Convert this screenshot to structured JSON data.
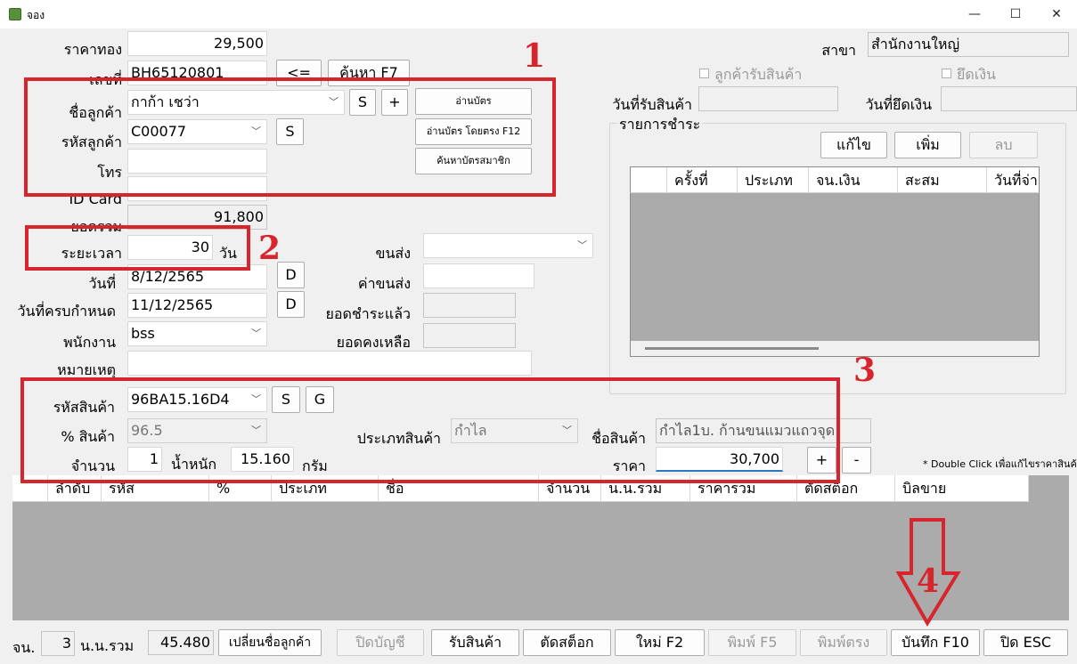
{
  "window": {
    "title": "จอง",
    "minimize": "—",
    "maximize": "☐",
    "close": "✕"
  },
  "form": {
    "gold_price_label": "ราคาทอง",
    "gold_price": "29,500",
    "doc_no_label": "เลขที่",
    "doc_no": "BH65120801",
    "back_button": "<=",
    "search_f7_button": "ค้นหา F7",
    "customer_name_label": "ชื่อลูกค้า",
    "customer_name": "กาก้า เชว่า",
    "customer_code_label": "รหัสลูกค้า",
    "customer_code": "C00077",
    "phone_label": "โทร",
    "phone": "",
    "idcard_label": "ID Card",
    "idcard": "",
    "balance_label": "ยอดรวม",
    "balance": "91,800",
    "duration_label": "ระยะเวลา",
    "duration": "30",
    "duration_unit": "วัน",
    "date_label": "วันที่",
    "date": "8/12/2565",
    "due_date_label": "วันที่ครบกำหนด",
    "due_date": "11/12/2565",
    "staff_label": "พนักงาน",
    "staff": "bss",
    "remark_label": "หมายเหตุ",
    "remark": "",
    "shipping_label": "ขนส่ง",
    "shipping": "",
    "shipping_cost_label": "ค่าขนส่ง",
    "shipping_cost": "",
    "paid_label": "ยอดชำระแล้ว",
    "paid": "",
    "remaining_label": "ยอดคงเหลือ",
    "remaining": "",
    "s_button": "S",
    "plus_button": "+",
    "d_button": "D",
    "g_button": "G",
    "minus_button": "-",
    "read_card_button": "อ่านบัตร",
    "read_card_direct_button": "อ่านบัตร โดยตรง F12",
    "search_member_button": "ค้นหาบัตรสมาชิก"
  },
  "right": {
    "branch_label": "สาขา",
    "branch": "สำนักงานใหญ่",
    "customer_receive_label": "ลูกค้ารับสินค้า",
    "seize_label": "ยึดเงิน",
    "receive_date_label": "วันที่รับสินค้า",
    "receive_date": "",
    "seize_date_label": "วันที่ยึดเงิน",
    "seize_date": "",
    "payments_title": "รายการชำระ",
    "edit_button": "แก้ไข",
    "add_button": "เพิ่ม",
    "delete_button": "ลบ",
    "payment_columns": [
      "ครั้งที่",
      "ประเภท",
      "จน.เงิน",
      "สะสม",
      "วันที่จ่าย"
    ]
  },
  "product": {
    "code_label": "รหัสสินค้า",
    "code": "96BA15.16D4",
    "percent_label": "% สินค้า",
    "percent": "96.5",
    "qty_label": "จำนวน",
    "qty": "1",
    "weight_label": "น้ำหนัก",
    "weight": "15.160",
    "weight_unit": "กรัม",
    "type_label": "ประเภทสินค้า",
    "type": "กำไล",
    "name_label": "ชื่อสินค้า",
    "name": "กำไล1บ. ก้านขนแมวแถวจุด",
    "price_label": "ราคา",
    "price": "30,700",
    "note": "* Double Click เพื่อแก้ไขราคาสินค้า"
  },
  "items_columns": [
    "ลำดับ",
    "รหัส",
    "%",
    "ประเภท",
    "ชื่อ",
    "จำนวน",
    "น.น.รวม",
    "ราคารวม",
    "ตัดสต็อก",
    "บิลขาย"
  ],
  "footer": {
    "count_label": "จน.",
    "count": "3",
    "total_weight_label": "น.น.รวม",
    "total_weight": "45.480",
    "change_name_button": "เปลี่ยนชื่อลูกค้า",
    "close_account_button": "ปิดบัญชี",
    "receive_button": "รับสินค้า",
    "cut_stock_button": "ตัดสต็อก",
    "new_button": "ใหม่ F2",
    "print_button": "พิมพ์ F5",
    "print_direct_button": "พิมพ์ตรง",
    "save_button": "บันทึก F10",
    "close_button": "ปิด ESC"
  },
  "annotations": [
    "1",
    "2",
    "3",
    "4"
  ],
  "colors": {
    "annotation_red": "#d7252e",
    "grid_gray": "#ababab"
  }
}
